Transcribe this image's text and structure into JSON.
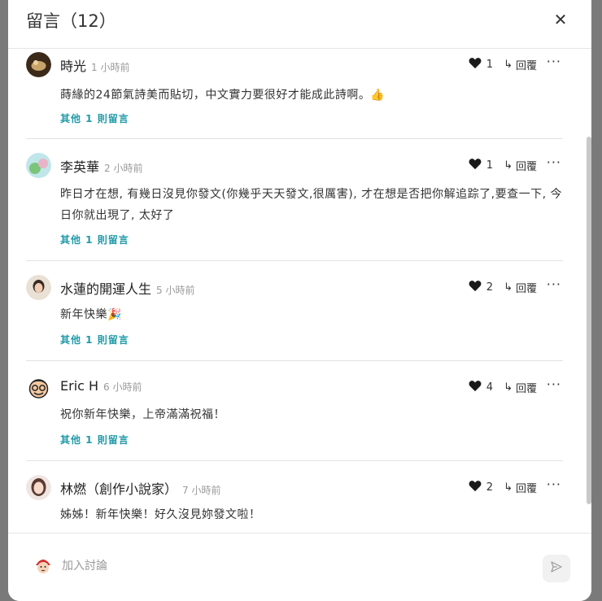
{
  "header": {
    "title": "留言（12）",
    "close_icon": "close-icon"
  },
  "comments": [
    {
      "name": "時光",
      "time": "1 小時前",
      "likes": "1",
      "reply_label": "回覆",
      "text": "蒔緣的24節氣詩美而貼切，中文實力要很好才能成此詩啊。👍",
      "more_replies": "其他 1 則留言"
    },
    {
      "name": "李英華",
      "time": "2 小時前",
      "likes": "1",
      "reply_label": "回覆",
      "text": "昨日才在想, 有幾日沒見你發文(你幾乎天天發文,很厲害), 才在想是否把你解追踪了,要查一下, 今日你就出現了, 太好了",
      "more_replies": "其他 1 則留言"
    },
    {
      "name": "水蓮的開運人生",
      "time": "5 小時前",
      "likes": "2",
      "reply_label": "回覆",
      "text": "新年快樂🎉",
      "more_replies": "其他 1 則留言"
    },
    {
      "name": "Eric H",
      "time": "6 小時前",
      "likes": "4",
      "reply_label": "回覆",
      "text": "祝你新年快樂，上帝滿滿祝福！",
      "more_replies": "其他 1 則留言"
    },
    {
      "name": "林燃（創作小說家）",
      "time": "7 小時前",
      "likes": "2",
      "reply_label": "回覆",
      "text": "姊姊！新年快樂！好久沒見妳發文啦！",
      "more_replies": ""
    }
  ],
  "footer": {
    "placeholder": "加入討論",
    "send_icon": "send-icon"
  },
  "colors": {
    "link": "#1f9aa8",
    "text": "#333333",
    "muted": "#9a9a9a"
  }
}
